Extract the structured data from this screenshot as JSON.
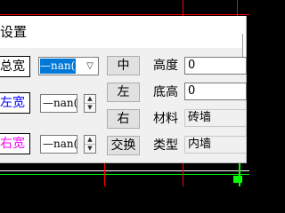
{
  "colors": {
    "canvas_background": "#000000",
    "cad_red": "#ff0000",
    "cad_green": "#00ff00",
    "selection_blue": "#0078d7",
    "side_label_blue": "#0000ff",
    "side_label_magenta": "#ff00ff"
  },
  "dialog": {
    "title": "设置",
    "rows": [
      {
        "side_label": "总宽",
        "side_color": "#000000",
        "width_value": "—nan(i",
        "align_button": "中",
        "field_label": "高度",
        "field_value": "0"
      },
      {
        "side_label": "左宽",
        "side_color": "#0000ff",
        "width_value": "—nan(i",
        "align_button": "左",
        "field_label": "底高",
        "field_value": "0"
      },
      {
        "side_label": "右宽",
        "side_color": "#ff00ff",
        "width_value": "—nan(i",
        "align_button": "右",
        "field_label": "材料",
        "field_value": "砖墙"
      }
    ],
    "swap_button": "交换",
    "type_label": "类型",
    "type_value": "内墙"
  },
  "icons": {
    "dropdown": "chevron-down-icon",
    "spin_up": "spin-up-icon",
    "spin_down": "spin-down-icon"
  }
}
